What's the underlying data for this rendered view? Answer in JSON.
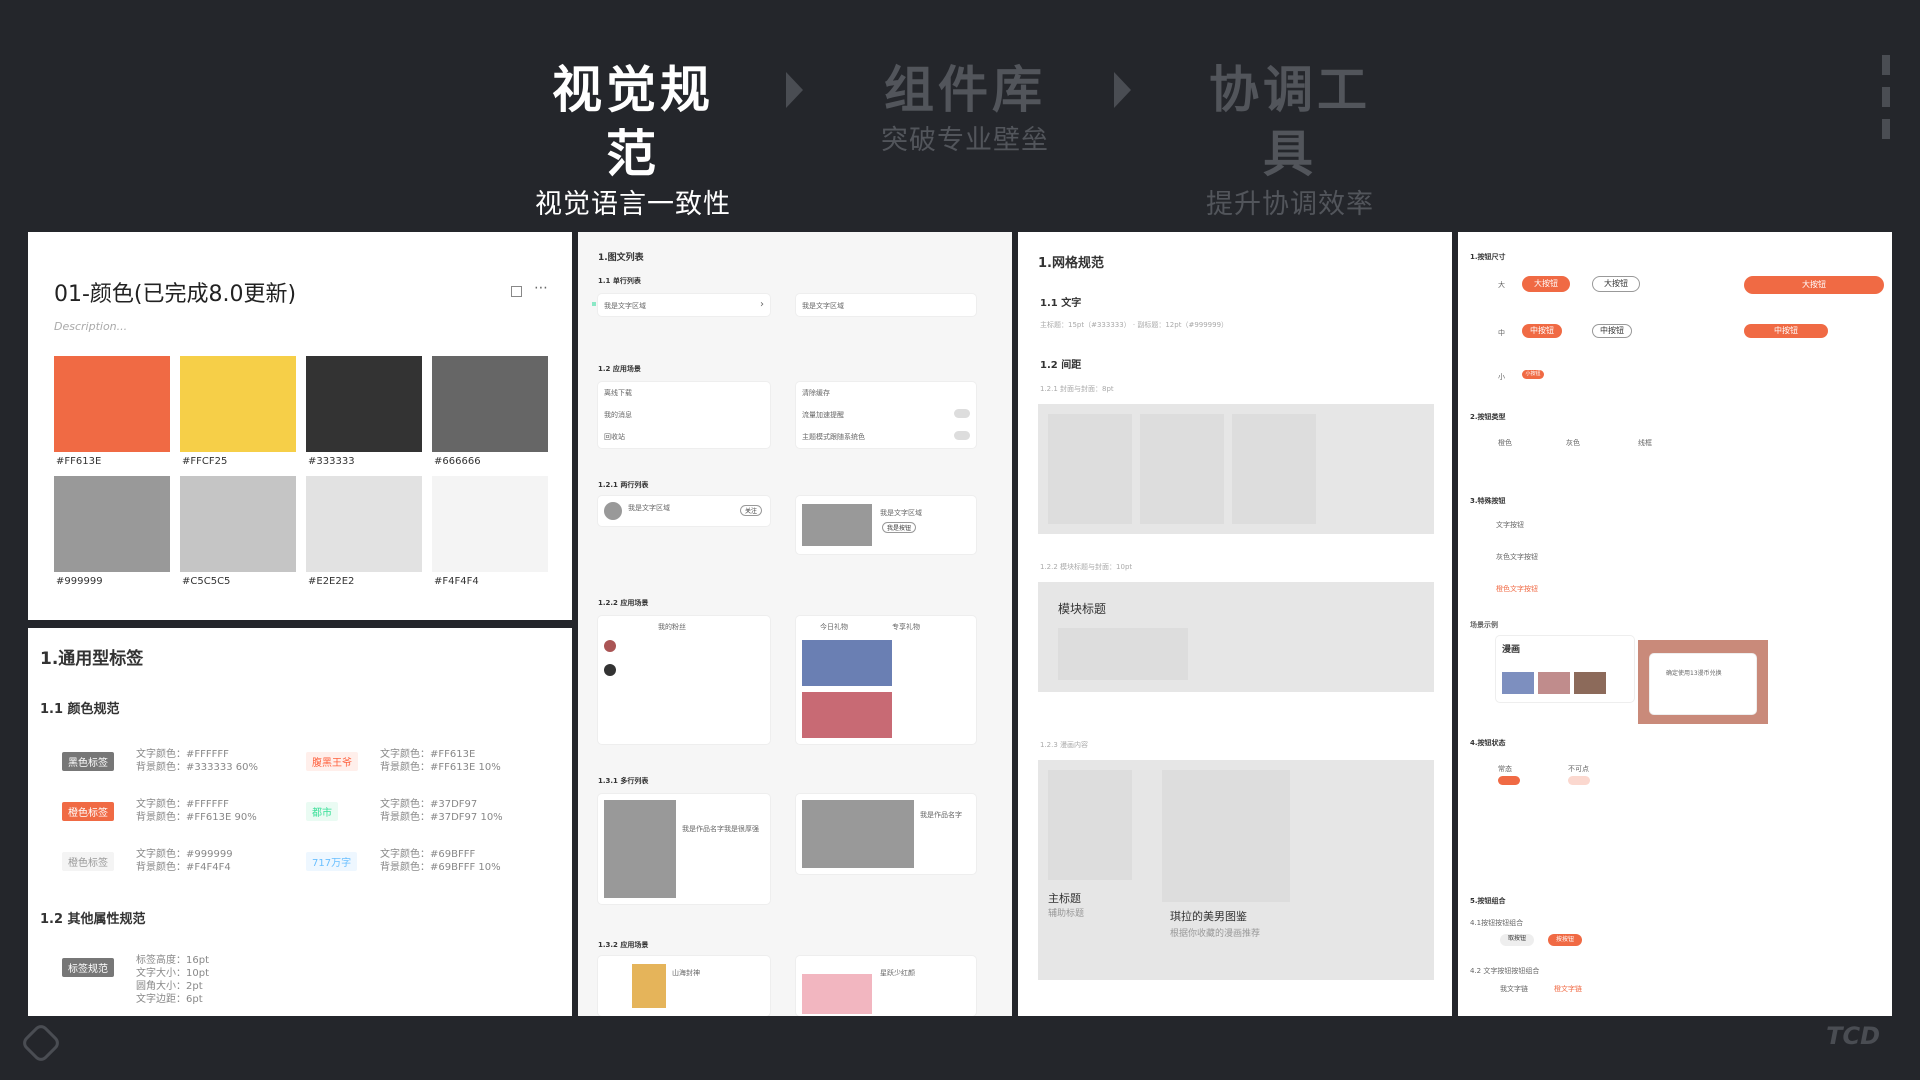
{
  "header": {
    "steps": [
      {
        "title": "视觉规范",
        "subtitle": "视觉语言一致性"
      },
      {
        "title": "组件库",
        "subtitle": "突破专业壁垒"
      },
      {
        "title": "协调工具",
        "subtitle": "提升协调效率"
      }
    ]
  },
  "colors_panel": {
    "title": "01-颜色(已完成8.0更新)",
    "description": "Description...",
    "swatches": [
      {
        "hex": "#FF613E",
        "color": "#f06a44"
      },
      {
        "hex": "#FFCF25",
        "color": "#f6cf48"
      },
      {
        "hex": "#333333",
        "color": "#333333"
      },
      {
        "hex": "#666666",
        "color": "#666666"
      },
      {
        "hex": "#999999",
        "color": "#999999"
      },
      {
        "hex": "#C5C5C5",
        "color": "#c5c5c5"
      },
      {
        "hex": "#E2E2E2",
        "color": "#e2e2e2"
      },
      {
        "hex": "#F4F4F4",
        "color": "#f4f4f4"
      }
    ]
  },
  "tags_panel": {
    "title": "1.通用型标签",
    "section1": "1.1 颜色规范",
    "tags": [
      {
        "label": "黑色标签",
        "l1": "文字颜色：#FFFFFF",
        "l2": "背景颜色：#333333 60%",
        "fg": "#ffffff",
        "bg": "#777777"
      },
      {
        "label": "腹黑王爷",
        "l1": "文字颜色：#FF613E",
        "l2": "背景颜色：#FF613E 10%",
        "fg": "#ff613e",
        "bg": "#ffefeb"
      },
      {
        "label": "橙色标签",
        "l1": "文字颜色：#FFFFFF",
        "l2": "背景颜色：#FF613E 90%",
        "fg": "#ffffff",
        "bg": "#f06a44"
      },
      {
        "label": "都市",
        "l1": "文字颜色：#37DF97",
        "l2": "背景颜色：#37DF97 10%",
        "fg": "#37df97",
        "bg": "#eafbf3"
      },
      {
        "label": "橙色标签",
        "l1": "文字颜色：#999999",
        "l2": "背景颜色：#F4F4F4",
        "fg": "#999999",
        "bg": "#f4f4f4"
      },
      {
        "label": "717万字",
        "l1": "文字颜色：#69BFFF",
        "l2": "背景颜色：#69BFFF 10%",
        "fg": "#69bfff",
        "bg": "#eef7ff"
      }
    ],
    "section2": "1.2 其他属性规范",
    "spec_tag": "标签规范",
    "specs": [
      "标签高度：16pt",
      "文字大小：10pt",
      "圆角大小：2pt",
      "文字边距：6pt"
    ]
  },
  "list_panel": {
    "title": "1.图文列表",
    "s11": "1.1 单行列表",
    "row_text": "我是文字区域",
    "s12": "1.2 应用场景",
    "items_left": [
      "离线下载",
      "我的消息",
      "回收站"
    ],
    "items_right": [
      "清除缓存",
      "流量加速提醒",
      "主题模式跟随系统色"
    ],
    "s121": "1.2.1 两行列表",
    "follow": "关注",
    "btn_text": "我是按钮",
    "s122": "1.2.2 应用场景",
    "fans_title": "我的粉丝",
    "gift_title": "今日礼物",
    "gift_title2": "专享礼物",
    "s131": "1.3.1 多行列表",
    "multi_title": "我是作品名字我是很厚强",
    "multi_title2": "我是作品名字",
    "s132": "1.3.2 应用场景",
    "app_title": "山海封神",
    "app_title2": "星跃少红颜"
  },
  "grid_panel": {
    "title": "1.网格规范",
    "s11": "1.1 文字",
    "s11_desc": "主标题：15pt（#333333） · 副标题：12pt（#999999）",
    "s12": "1.2 间距",
    "s121": "1.2.1 封面与封面：8pt",
    "s122": "1.2.2 模块标题与封面：10pt",
    "module_title": "模块标题",
    "s123": "1.2.3 漫画内容",
    "main_title": "主标题",
    "sub_title": "辅助标题",
    "card_title": "琪拉的美男图鉴",
    "card_sub": "根据你收藏的漫画推荐"
  },
  "button_panel": {
    "s1": "1.按钮尺寸",
    "size_large": "大",
    "size_mid": "中",
    "size_small": "小",
    "btn_large": "大按钮",
    "btn_mid": "中按钮",
    "btn_small": "小按钮",
    "s2": "2.按钮类型",
    "types": [
      "橙色",
      "灰色",
      "线框"
    ],
    "s3": "3.特殊按钮",
    "special": [
      "文字按钮",
      "灰色文字按钮",
      "橙色文字按钮"
    ],
    "scene": "场景示例",
    "manga": "漫画",
    "dialog": "确定使用13漫币兑换",
    "s4": "4.按钮状态",
    "states": [
      "常态",
      "不可点"
    ],
    "s5": "5.按钮组合",
    "combo1": "4.1按钮按钮组合",
    "combo_a": "取按钮",
    "combo_b": "按按钮",
    "combo2": "4.2 文字按钮按钮组合",
    "txt_a": "我文字链",
    "txt_b": "橙文字链"
  },
  "footer": {
    "brand": "TCD"
  }
}
